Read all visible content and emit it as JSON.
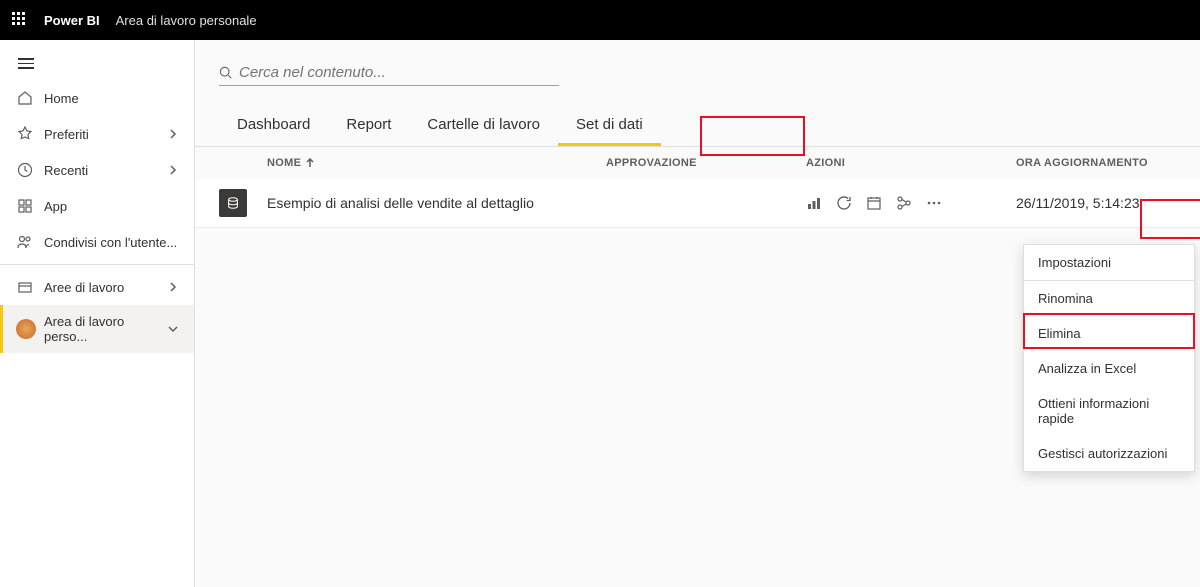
{
  "topbar": {
    "brand": "Power BI",
    "breadcrumb": "Area di lavoro personale"
  },
  "sidebar": {
    "home": "Home",
    "favorites": "Preferiti",
    "recent": "Recenti",
    "apps": "App",
    "shared": "Condivisi con l'utente...",
    "workspaces": "Aree di lavoro",
    "myworkspace": "Area di lavoro perso..."
  },
  "search": {
    "placeholder": "Cerca nel contenuto..."
  },
  "tabs": {
    "dashboard": "Dashboard",
    "report": "Report",
    "workbooks": "Cartelle di lavoro",
    "datasets": "Set di dati"
  },
  "columns": {
    "name": "NOME",
    "approval": "APPROVAZIONE",
    "actions": "AZIONI",
    "refresh": "ORA AGGIORNAMENTO"
  },
  "row": {
    "name": "Esempio di analisi delle vendite al dettaglio",
    "time": "26/11/2019, 5:14:23"
  },
  "menu": {
    "settings": "Impostazioni",
    "rename": "Rinomina",
    "delete": "Elimina",
    "analyze": "Analizza in Excel",
    "insights": "Ottieni informazioni rapide",
    "permissions": "Gestisci autorizzazioni"
  }
}
